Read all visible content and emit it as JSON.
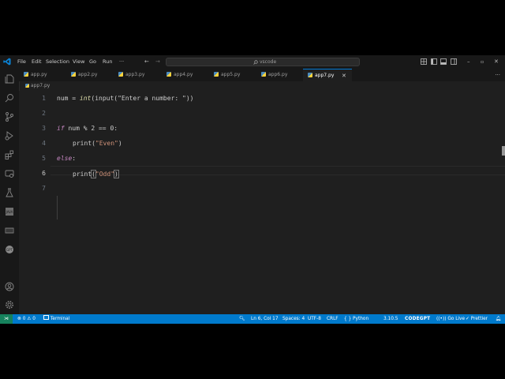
{
  "menu": {
    "file": "File",
    "edit": "Edit",
    "selection": "Selection",
    "view": "View",
    "go": "Go",
    "run": "Run",
    "more": "···"
  },
  "search": {
    "text": "vscode"
  },
  "tabs": [
    {
      "label": "app.py"
    },
    {
      "label": "app2.py"
    },
    {
      "label": "app3.py"
    },
    {
      "label": "app4.py"
    },
    {
      "label": "app5.py"
    },
    {
      "label": "app6.py"
    },
    {
      "label": "app7.py",
      "active": true
    }
  ],
  "breadcrumb": {
    "file": "app7.py"
  },
  "editor": {
    "line_numbers": [
      "1",
      "2",
      "3",
      "4",
      "5",
      "6",
      "7"
    ],
    "lines": {
      "l1": {
        "var": "num",
        "eq": " = ",
        "int": "int",
        "p1": "(",
        "input": "input",
        "p2": "(",
        "str": "\"Enter a number: \"",
        "p3": "))"
      },
      "l3": {
        "kw": "if",
        "rest": " num % 2 == 0:"
      },
      "l4": {
        "print": "print",
        "p1": "(",
        "str": "\"Even\"",
        "p2": ")"
      },
      "l5": {
        "kw": "else",
        "colon": ":"
      },
      "l6": {
        "print": "print",
        "p1": "(",
        "str": "\"Odd\"",
        "p2": ")"
      }
    }
  },
  "status": {
    "errors": "⊗ 0 ⚠ 0",
    "terminal": "Terminal",
    "position": "Ln 6, Col 17",
    "spaces": "Spaces: 4",
    "encoding": "UTF-8",
    "eol": "CRLF",
    "language": "{ } Python",
    "version": "3.10.5",
    "codegpt": "CODEGPT",
    "golive": "Go Live",
    "prettier": "✓ Prettier"
  },
  "colors": {
    "accent": "#007acc",
    "tab_active_border": "#0078d4",
    "keyword": "#c586c0",
    "string": "#ce9178",
    "function": "#dcdcaa"
  }
}
